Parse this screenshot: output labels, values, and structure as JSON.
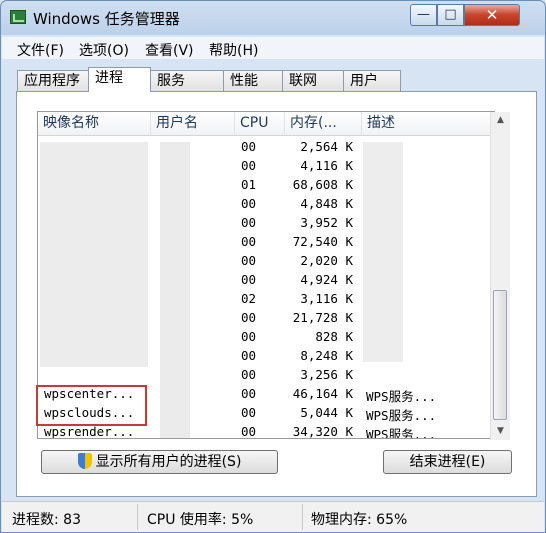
{
  "window": {
    "title": "Windows 任务管理器",
    "min": "—",
    "max": "□",
    "close": "✕"
  },
  "menu": [
    "文件(F)",
    "选项(O)",
    "查看(V)",
    "帮助(H)"
  ],
  "tabs": [
    "应用程序",
    "进程",
    "服务",
    "性能",
    "联网",
    "用户"
  ],
  "active_tab": "进程",
  "columns": [
    "映像名称",
    "用户名",
    "CPU",
    "内存(...",
    "描述"
  ],
  "rows": [
    {
      "image": "",
      "user": "",
      "cpu": "00",
      "mem": "2,564 K",
      "desc": ""
    },
    {
      "image": "",
      "user": "",
      "cpu": "00",
      "mem": "4,116 K",
      "desc": ""
    },
    {
      "image": "",
      "user": "",
      "cpu": "01",
      "mem": "68,608 K",
      "desc": ""
    },
    {
      "image": "",
      "user": "",
      "cpu": "00",
      "mem": "4,848 K",
      "desc": ""
    },
    {
      "image": "",
      "user": "",
      "cpu": "00",
      "mem": "3,952 K",
      "desc": ""
    },
    {
      "image": "",
      "user": "",
      "cpu": "00",
      "mem": "72,540 K",
      "desc": ""
    },
    {
      "image": "",
      "user": "",
      "cpu": "00",
      "mem": "2,020 K",
      "desc": ""
    },
    {
      "image": "",
      "user": "",
      "cpu": "00",
      "mem": "4,924 K",
      "desc": ""
    },
    {
      "image": "",
      "user": "",
      "cpu": "02",
      "mem": "3,116 K",
      "desc": ""
    },
    {
      "image": "",
      "user": "",
      "cpu": "00",
      "mem": "21,728 K",
      "desc": ""
    },
    {
      "image": "",
      "user": "",
      "cpu": "00",
      "mem": "828 K",
      "desc": ""
    },
    {
      "image": "",
      "user": "",
      "cpu": "00",
      "mem": "8,248 K",
      "desc": ""
    },
    {
      "image": "",
      "user": "",
      "cpu": "00",
      "mem": "3,256 K",
      "desc": ""
    },
    {
      "image": "wpscenter...",
      "user": "",
      "cpu": "00",
      "mem": "46,164 K",
      "desc": "WPS服务..."
    },
    {
      "image": "wpsclouds...",
      "user": "",
      "cpu": "00",
      "mem": "5,044 K",
      "desc": "WPS服务..."
    },
    {
      "image": "wpsrender...",
      "user": "",
      "cpu": "00",
      "mem": "34,320 K",
      "desc": "WPS服务..."
    }
  ],
  "buttons": {
    "show_all": "显示所有用户的进程(S)",
    "end_process": "结束进程(E)"
  },
  "status": {
    "processes": "进程数: 83",
    "cpu": "CPU 使用率: 5%",
    "memory": "物理内存: 65%"
  },
  "colors": {
    "highlight_box": "#c83a3a",
    "titlebar": "#bcd1ea"
  }
}
